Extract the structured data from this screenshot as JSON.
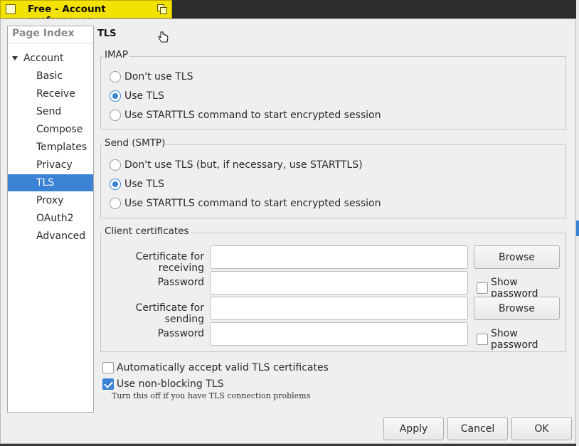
{
  "window": {
    "title": "Free - Account preferences"
  },
  "sidebar": {
    "header": "Page Index",
    "parent": "Account",
    "items": [
      "Basic",
      "Receive",
      "Send",
      "Compose",
      "Templates",
      "Privacy",
      "TLS",
      "Proxy",
      "OAuth2",
      "Advanced"
    ],
    "selected": "TLS"
  },
  "page": {
    "title": "TLS"
  },
  "imap": {
    "label": "IMAP",
    "options": [
      "Don't use TLS",
      "Use TLS",
      "Use STARTTLS command to start encrypted session"
    ],
    "selected": "Use TLS"
  },
  "smtp": {
    "label": "Send (SMTP)",
    "options": [
      "Don't use TLS (but, if necessary, use STARTTLS)",
      "Use TLS",
      "Use STARTTLS command to start encrypted session"
    ],
    "selected": "Use TLS"
  },
  "certs": {
    "label": "Client certificates",
    "receiving_label": "Certificate for receiving",
    "sending_label": "Certificate for sending",
    "password_label": "Password",
    "browse": "Browse",
    "show_password": "Show password",
    "receiving_value": "",
    "receiving_password": "",
    "sending_value": "",
    "sending_password": ""
  },
  "options": {
    "auto_accept": "Automatically accept valid TLS certificates",
    "auto_accept_checked": false,
    "nonblocking": "Use non-blocking TLS",
    "nonblocking_checked": true,
    "nonblocking_hint": "Turn this off if you have TLS connection problems"
  },
  "buttons": {
    "apply": "Apply",
    "cancel": "Cancel",
    "ok": "OK"
  },
  "colors": {
    "accent": "#3b82d4",
    "titlebar": "#f3e100"
  }
}
